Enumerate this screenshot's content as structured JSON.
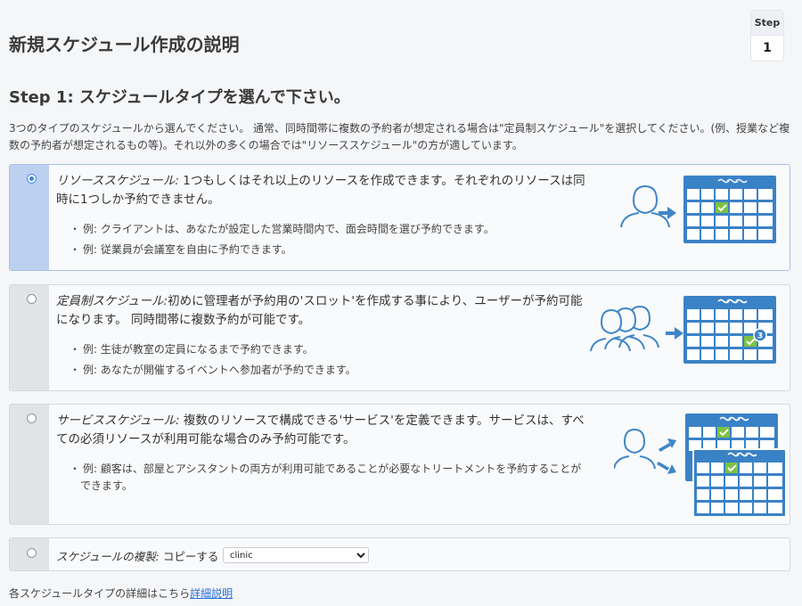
{
  "page": {
    "title": "新規スケジュール作成の説明",
    "step_label": "Step",
    "step_number": "1"
  },
  "section": {
    "title": "Step 1: スケジュールタイプを選んで下さい。",
    "intro": "3つのタイプのスケジュールから選んでください。 通常、同時間帯に複数の予約者が想定される場合は\"定員制スケジュール\"を選択してください。(例、授業など複数の予約者が想定されるもの等)。それ以外の多くの場合では\"リソーススケジュール\"の方が適しています。"
  },
  "options": [
    {
      "name": "リソーススケジュール:",
      "description": " 1つもしくはそれ以上のリソースを作成できます。それぞれのリソースは同時に1つしか予約できません。",
      "bullets": [
        "例: クライアントは、あなたが設定した営業時間内で、面会時間を選び予約できます。",
        "例: 従業員が会議室を自由に予約できます。"
      ],
      "selected": true
    },
    {
      "name": "定員制スケジュール:",
      "description": "初めに管理者が予約用の'スロット'を作成する事により、ユーザーが予約可能になります。 同時間帯に複数予約が可能です。",
      "bullets": [
        "例: 生徒が教室の定員になるまで予約できます。",
        "例: あなたが開催するイベントへ参加者が予約できます。"
      ],
      "badge": "3",
      "selected": false
    },
    {
      "name": "サービススケジュール:",
      "description": " 複数のリソースで構成できる'サービス'を定義できます。サービスは、すべての必須リソースが利用可能な場合のみ予約可能です。",
      "bullets": [
        "例: 顧客は、部屋とアシスタントの両方が利用可能であることが必要なトリートメントを予約することができます。"
      ],
      "selected": false
    }
  ],
  "copy": {
    "name": "スケジュールの複製:",
    "label": " コピーする",
    "selected_value": "clinic"
  },
  "footer": {
    "text": "各スケジュールタイプの詳細はこちら",
    "link": "詳細説明"
  },
  "colors": {
    "calendar_blue": "#3a82c6",
    "check_green": "#7cc242",
    "icon_blue": "#3f87c8"
  }
}
